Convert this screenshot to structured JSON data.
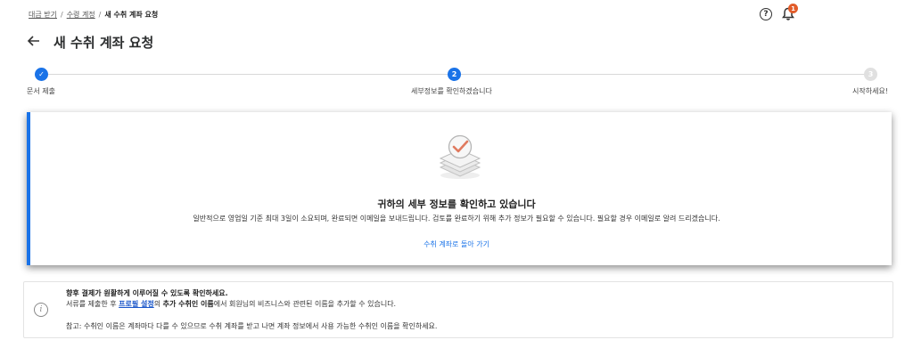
{
  "breadcrumb": {
    "item1": "대금 받기",
    "item2": "수령 계정",
    "current": "새 수취 계좌 요청",
    "separator": "/"
  },
  "header": {
    "help_icon": "help-circle-icon",
    "notification_count": "1",
    "badge_color": "#e25c2a"
  },
  "page": {
    "title": "새 수취 계좌 요청"
  },
  "stepper": {
    "steps": [
      {
        "label": "문서 제출",
        "status": "complete",
        "marker": "✓"
      },
      {
        "label": "세부정보를 확인하겠습니다",
        "status": "current",
        "marker": "2"
      },
      {
        "label": "시작하세요!",
        "status": "upcoming",
        "marker": "3"
      }
    ],
    "accent_color": "#1a73e8"
  },
  "card": {
    "heading": "귀하의 세부 정보를 확인하고 있습니다",
    "text": "일반적으로 영업일 기준 최대 3일이 소요되며, 완료되면 이메일을 보내드립니다. 검토를 완료하기 위해 추가 정보가 필요할 수 있습니다. 필요할 경우 이메일로 알려 드리겠습니다.",
    "link": "수취 계좌로 돌아 가기"
  },
  "info": {
    "title": "향후 결제가 원활하게 이루어질 수 있도록 확인하세요.",
    "line2_prefix": "서류를 제출한 후 ",
    "line2_link": "프로필 설정",
    "line2_mid": "의 ",
    "line2_bold": "추가 수취인 이름",
    "line2_suffix": "에서 회원님의 비즈니스와 관련된 이름을 추가할 수 있습니다.",
    "note": "참고: 수취인 이름은 계좌마다 다를 수 있으므로 수취 계좌를 받고 나면 계좌 정보에서 사용 가능한 수취인 이름을 확인하세요."
  }
}
